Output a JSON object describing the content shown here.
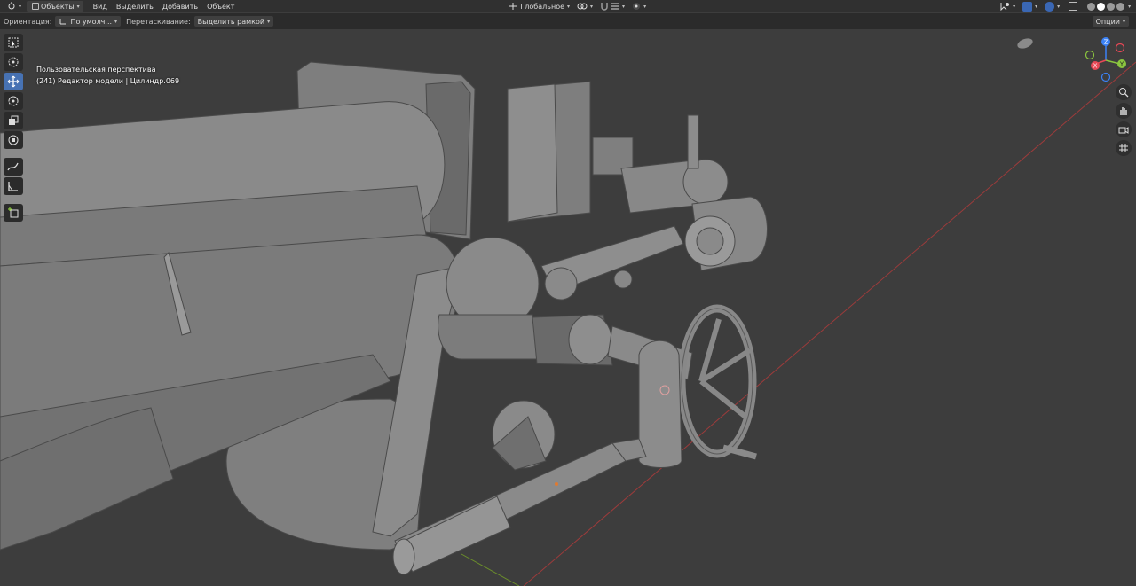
{
  "header": {
    "editor_icon": "view3d-icon",
    "mode_label": "Объекты",
    "menus": [
      "Вид",
      "Выделить",
      "Добавить",
      "Объект"
    ],
    "transform_orientation": "Глобальное",
    "shading_modes": [
      "wireframe",
      "solid",
      "material",
      "rendered"
    ],
    "active_shading": "solid"
  },
  "tool_settings": {
    "orientation_label": "Ориентация:",
    "orientation_value": "По умолч...",
    "drag_label": "Перетаскивание:",
    "drag_value": "Выделить рамкой",
    "options_label": "Опции"
  },
  "viewport": {
    "perspective_label": "Пользовательская перспектива",
    "object_info": "(241) Редактор модели | Цилиндр.069"
  },
  "toolbar": {
    "tools": [
      "select-box",
      "cursor",
      "move",
      "rotate",
      "scale",
      "transform",
      "annotate",
      "measure",
      "add-cube"
    ],
    "active_tool": "move"
  },
  "gizmo": {
    "axes": [
      "X",
      "Y",
      "Z"
    ],
    "colors": {
      "x": "#e74856",
      "y": "#8bc53f",
      "z": "#3b82f6"
    }
  },
  "colors": {
    "accent": "#4772b3",
    "header_bg": "#303030",
    "viewport_bg": "#3d3d3d",
    "x_axis_line": "#9c3b3b",
    "y_axis_line": "#6b8e2b"
  }
}
